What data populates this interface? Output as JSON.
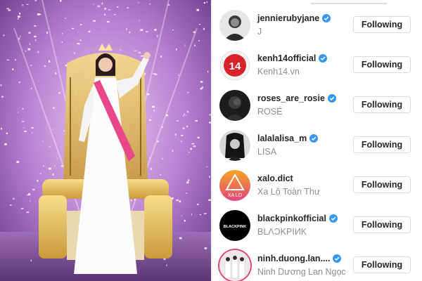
{
  "colors": {
    "verified": "#3897f0",
    "username": "#262626",
    "fullname": "#8e8e8e",
    "button_border": "#dbdbdb",
    "kenh14_red": "#d8232a",
    "xalo_gradient_top": "#f5a623",
    "xalo_gradient_bottom": "#e0457b"
  },
  "following_list": [
    {
      "username": "jennierubyjane",
      "fullname": "J",
      "verified": true,
      "button": "Following",
      "avatar_icon": "profile-photo-icon"
    },
    {
      "username": "kenh14official",
      "fullname": "Kenh14.vn",
      "verified": true,
      "button": "Following",
      "avatar_icon": "kenh14-logo-icon",
      "avatar_text": "14"
    },
    {
      "username": "roses_are_rosie",
      "fullname": "ROSÉ",
      "verified": true,
      "button": "Following",
      "avatar_icon": "profile-photo-icon"
    },
    {
      "username": "lalalalisa_m",
      "fullname": "LISA",
      "verified": true,
      "button": "Following",
      "avatar_icon": "profile-photo-icon"
    },
    {
      "username": "xalo.dict",
      "fullname": "Xa Lộ Toàn Thư",
      "verified": false,
      "button": "Following",
      "avatar_icon": "xalo-logo-icon",
      "avatar_text": "XA LO"
    },
    {
      "username": "blackpinkofficial",
      "fullname": "BLΛƆKPIИK",
      "verified": true,
      "button": "Following",
      "avatar_icon": "blackpink-logo-icon",
      "avatar_text": "BLACKPINK"
    },
    {
      "username": "ninh.duong.lan....",
      "fullname": "Ninh Dương Lan Ngọc",
      "verified": true,
      "button": "Following",
      "avatar_icon": "profile-photo-icon"
    }
  ]
}
